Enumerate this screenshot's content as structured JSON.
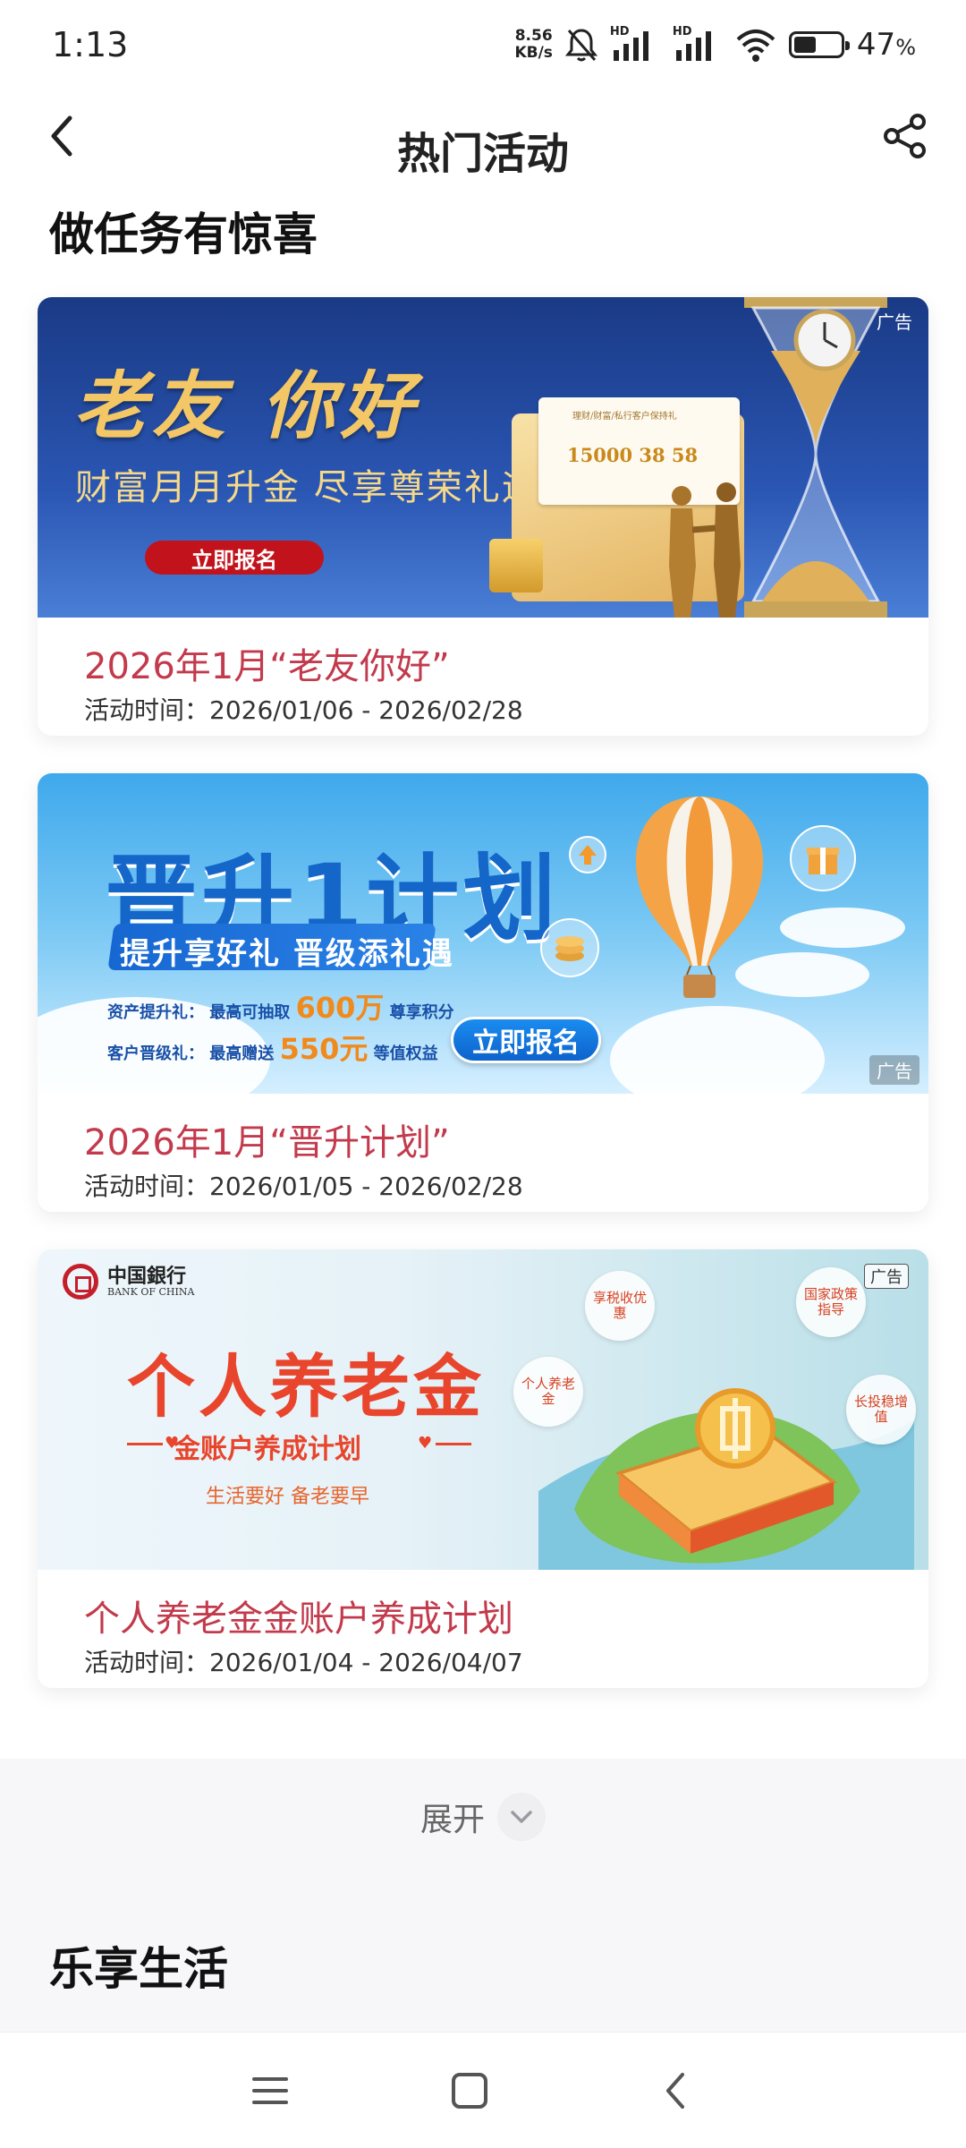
{
  "status_bar": {
    "time": "1:13",
    "net_speed_value": "8.56",
    "net_speed_unit": "KB/s",
    "hd1": "HD",
    "hd2": "HD",
    "battery_percent": "47",
    "battery_suffix": "%",
    "battery_level": 0.47
  },
  "nav": {
    "title": "热门活动"
  },
  "sections": {
    "tasks_title": "做任务有惊喜",
    "life_title": "乐享生活"
  },
  "cards": [
    {
      "title": "2026年1月“老友你好”",
      "time": "活动时间：2026/01/06 - 2026/02/28",
      "ad_badge": "广告",
      "banner": {
        "headline": "老友 你好",
        "subline": "财富月月升金  尽享尊荣礼遇",
        "button": "立即报名",
        "letter_head": "理财/财富/私行客户保持礼",
        "letter_nums": "15000  38  58"
      }
    },
    {
      "title": "2026年1月“晋升计划”",
      "time": "活动时间：2026/01/05 - 2026/02/28",
      "ad_badge": "广告",
      "banner": {
        "headline": "晋升1计划",
        "ribbon": "提升享好礼  晋级添礼遇",
        "line1_label": "资产提升礼：",
        "line1_pre": "最高可抽取",
        "line1_big": "600万",
        "line1_post": "尊享积分",
        "line2_label": "客户晋级礼：",
        "line2_pre": "最高赠送",
        "line2_big": "550元",
        "line2_post": "等值权益",
        "button": "立即报名"
      }
    },
    {
      "title": "个人养老金金账户养成计划",
      "time": "活动时间：2026/01/04 - 2026/04/07",
      "ad_badge": "广告",
      "banner": {
        "logo_cn": "中国銀行",
        "logo_en": "BANK OF CHINA",
        "headline": "个人养老金",
        "subline": "金账户养成计划",
        "slogan": "生活要好  备老要早",
        "bubble1": "享税收优惠",
        "bubble2": "国家政策指导",
        "bubble3": "个人养老金",
        "bubble4": "长投稳增值"
      }
    }
  ],
  "expand": {
    "label": "展开"
  },
  "icons": {
    "back": "chevron-left-icon",
    "share": "share-icon",
    "expand": "chevron-down-icon",
    "sys_menu": "menu-icon",
    "sys_home": "home-square-icon",
    "sys_back": "back-icon"
  },
  "colors": {
    "card_title": "#c23a4c",
    "b1_bg": "#1a3a85",
    "b2_bg": "#3fa9ec",
    "b3_headline": "#e8452c"
  }
}
